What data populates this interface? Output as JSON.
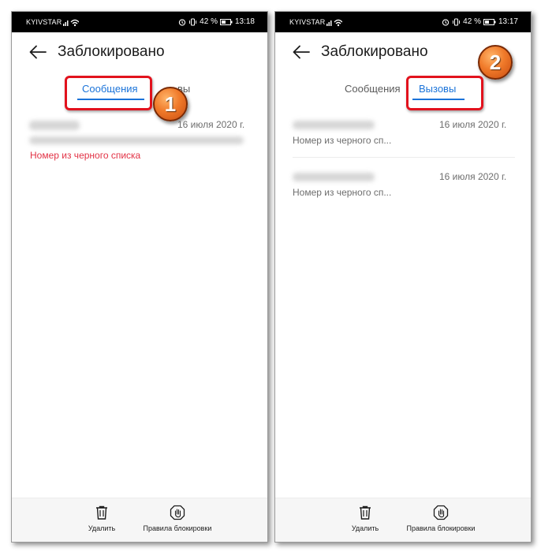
{
  "left_screen": {
    "status": {
      "carrier": "KYIVSTAR",
      "battery": "42 %",
      "time": "13:18"
    },
    "title": "Заблокировано",
    "tabs": {
      "messages": "Сообщения",
      "calls_partial": "вы",
      "calls_hidden_first": "Вызо"
    },
    "active_tab": "messages",
    "badge": "1",
    "items": [
      {
        "date": "16 июля 2020 г.",
        "reason": "Номер из черного списка"
      }
    ],
    "bottom": {
      "delete": "Удалить",
      "rules": "Правила блокировки"
    }
  },
  "right_screen": {
    "status": {
      "carrier": "KYIVSTAR",
      "battery": "42 %",
      "time": "13:17"
    },
    "title": "Заблокировано",
    "tabs": {
      "messages": "Сообщения",
      "calls": "Вызовы"
    },
    "active_tab": "calls",
    "badge": "2",
    "items": [
      {
        "date": "16 июля 2020 г.",
        "reason": "Номер из черного сп..."
      },
      {
        "date": "16 июля 2020 г.",
        "reason": "Номер из черного сп..."
      }
    ],
    "bottom": {
      "delete": "Удалить",
      "rules": "Правила блокировки"
    }
  },
  "colors": {
    "accent": "#1a73d9",
    "highlight": "#e2121d",
    "badge": "#f07a2a",
    "error_text": "#e23245"
  }
}
